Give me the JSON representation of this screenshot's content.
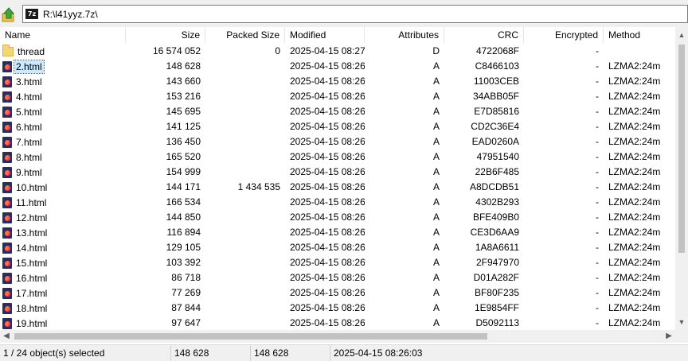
{
  "address": {
    "path": "R:\\l41yyz.7z\\",
    "archive_icon_label": "7z"
  },
  "columns": [
    {
      "label": "Name"
    },
    {
      "label": "Size"
    },
    {
      "label": "Packed Size"
    },
    {
      "label": "Modified"
    },
    {
      "label": "Attributes"
    },
    {
      "label": "CRC"
    },
    {
      "label": "Encrypted"
    },
    {
      "label": "Method"
    }
  ],
  "rows": [
    {
      "name": "thread",
      "type": "folder",
      "size": "16 574 052",
      "packed": "0",
      "modified": "2025-04-15 08:27",
      "attr": "D",
      "crc": "4722068F",
      "enc": "-",
      "method": ""
    },
    {
      "name": "2.html",
      "type": "html",
      "size": "148 628",
      "packed": "",
      "modified": "2025-04-15 08:26",
      "attr": "A",
      "crc": "C8466103",
      "enc": "-",
      "method": "LZMA2:24m",
      "selected": true
    },
    {
      "name": "3.html",
      "type": "html",
      "size": "143 660",
      "packed": "",
      "modified": "2025-04-15 08:26",
      "attr": "A",
      "crc": "11003CEB",
      "enc": "-",
      "method": "LZMA2:24m"
    },
    {
      "name": "4.html",
      "type": "html",
      "size": "153 216",
      "packed": "",
      "modified": "2025-04-15 08:26",
      "attr": "A",
      "crc": "34ABB05F",
      "enc": "-",
      "method": "LZMA2:24m"
    },
    {
      "name": "5.html",
      "type": "html",
      "size": "145 695",
      "packed": "",
      "modified": "2025-04-15 08:26",
      "attr": "A",
      "crc": "E7D85816",
      "enc": "-",
      "method": "LZMA2:24m"
    },
    {
      "name": "6.html",
      "type": "html",
      "size": "141 125",
      "packed": "",
      "modified": "2025-04-15 08:26",
      "attr": "A",
      "crc": "CD2C36E4",
      "enc": "-",
      "method": "LZMA2:24m"
    },
    {
      "name": "7.html",
      "type": "html",
      "size": "136 450",
      "packed": "",
      "modified": "2025-04-15 08:26",
      "attr": "A",
      "crc": "EAD0260A",
      "enc": "-",
      "method": "LZMA2:24m"
    },
    {
      "name": "8.html",
      "type": "html",
      "size": "165 520",
      "packed": "",
      "modified": "2025-04-15 08:26",
      "attr": "A",
      "crc": "47951540",
      "enc": "-",
      "method": "LZMA2:24m"
    },
    {
      "name": "9.html",
      "type": "html",
      "size": "154 999",
      "packed": "",
      "modified": "2025-04-15 08:26",
      "attr": "A",
      "crc": "22B6F485",
      "enc": "-",
      "method": "LZMA2:24m"
    },
    {
      "name": "10.html",
      "type": "html",
      "size": "144 171",
      "packed": "1 434 535",
      "modified": "2025-04-15 08:26",
      "attr": "A",
      "crc": "A8DCDB51",
      "enc": "-",
      "method": "LZMA2:24m"
    },
    {
      "name": "11.html",
      "type": "html",
      "size": "166 534",
      "packed": "",
      "modified": "2025-04-15 08:26",
      "attr": "A",
      "crc": "4302B293",
      "enc": "-",
      "method": "LZMA2:24m"
    },
    {
      "name": "12.html",
      "type": "html",
      "size": "144 850",
      "packed": "",
      "modified": "2025-04-15 08:26",
      "attr": "A",
      "crc": "BFE409B0",
      "enc": "-",
      "method": "LZMA2:24m"
    },
    {
      "name": "13.html",
      "type": "html",
      "size": "116 894",
      "packed": "",
      "modified": "2025-04-15 08:26",
      "attr": "A",
      "crc": "CE3D6AA9",
      "enc": "-",
      "method": "LZMA2:24m"
    },
    {
      "name": "14.html",
      "type": "html",
      "size": "129 105",
      "packed": "",
      "modified": "2025-04-15 08:26",
      "attr": "A",
      "crc": "1A8A6611",
      "enc": "-",
      "method": "LZMA2:24m"
    },
    {
      "name": "15.html",
      "type": "html",
      "size": "103 392",
      "packed": "",
      "modified": "2025-04-15 08:26",
      "attr": "A",
      "crc": "2F947970",
      "enc": "-",
      "method": "LZMA2:24m"
    },
    {
      "name": "16.html",
      "type": "html",
      "size": "86 718",
      "packed": "",
      "modified": "2025-04-15 08:26",
      "attr": "A",
      "crc": "D01A282F",
      "enc": "-",
      "method": "LZMA2:24m"
    },
    {
      "name": "17.html",
      "type": "html",
      "size": "77 269",
      "packed": "",
      "modified": "2025-04-15 08:26",
      "attr": "A",
      "crc": "BF80F235",
      "enc": "-",
      "method": "LZMA2:24m"
    },
    {
      "name": "18.html",
      "type": "html",
      "size": "87 844",
      "packed": "",
      "modified": "2025-04-15 08:26",
      "attr": "A",
      "crc": "1E9854FF",
      "enc": "-",
      "method": "LZMA2:24m"
    },
    {
      "name": "19.html",
      "type": "html",
      "size": "97 647",
      "packed": "",
      "modified": "2025-04-15 08:26",
      "attr": "A",
      "crc": "D5092113",
      "enc": "-",
      "method": "LZMA2:24m"
    }
  ],
  "status": {
    "selection": "1 / 24 object(s) selected",
    "size": "148 628",
    "packed": "148 628",
    "modified": "2025-04-15 08:26:03"
  },
  "colors": {
    "selection_bg": "#cce8ff",
    "chrome_bg": "#f0f0f0"
  },
  "icons": {
    "up": "up-folder-arrow-icon",
    "archive": "7z-archive-icon",
    "folder": "folder-icon",
    "html": "html-file-icon"
  }
}
